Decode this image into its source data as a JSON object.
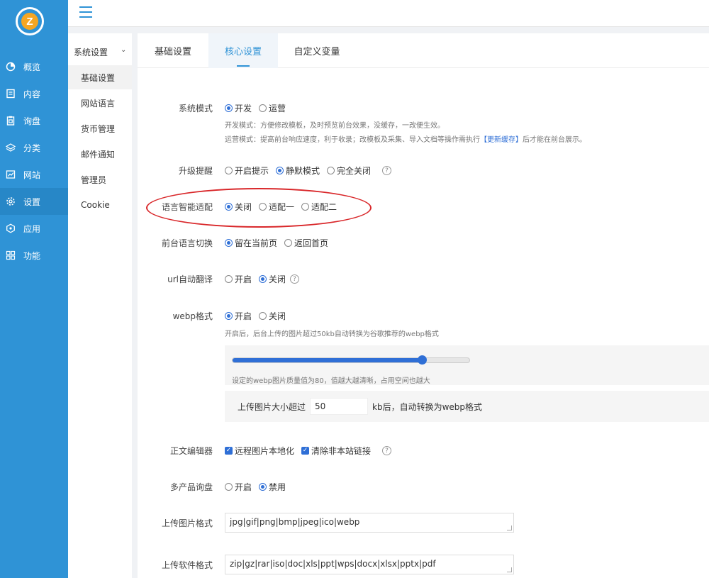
{
  "app": {
    "logo_letter": "Z"
  },
  "nav": {
    "items": [
      {
        "label": "概览",
        "icon": "pie-chart-icon"
      },
      {
        "label": "内容",
        "icon": "document-icon"
      },
      {
        "label": "询盘",
        "icon": "clipboard-icon"
      },
      {
        "label": "分类",
        "icon": "layers-icon"
      },
      {
        "label": "网站",
        "icon": "chart-window-icon"
      },
      {
        "label": "设置",
        "icon": "gear-icon",
        "active": true
      },
      {
        "label": "应用",
        "icon": "hexagon-icon"
      },
      {
        "label": "功能",
        "icon": "grid-icon"
      }
    ]
  },
  "subnav": {
    "title": "系统设置",
    "items": [
      {
        "label": "基础设置",
        "active": true
      },
      {
        "label": "网站语言"
      },
      {
        "label": "货币管理"
      },
      {
        "label": "邮件通知"
      },
      {
        "label": "管理员"
      },
      {
        "label": "Cookie"
      }
    ]
  },
  "tabs": [
    {
      "label": "基础设置"
    },
    {
      "label": "核心设置",
      "active": true
    },
    {
      "label": "自定义变量"
    }
  ],
  "form": {
    "system_mode": {
      "label": "系统模式",
      "options": [
        "开发",
        "运营"
      ],
      "selected": "开发",
      "hint1": "开发模式：方便修改模板，及时预览前台效果，没缓存，一改便生效。",
      "hint2_pre": "运营模式：提高前台响应速度，利于收录；改模板及采集、导入文档等操作需执行",
      "hint2_link": "【更新缓存】",
      "hint2_post": "后才能在前台展示。"
    },
    "upgrade_notice": {
      "label": "升级提醒",
      "options": [
        "开启提示",
        "静默模式",
        "完全关闭"
      ],
      "selected": "静默模式"
    },
    "lang_adapt": {
      "label": "语言智能适配",
      "options": [
        "关闭",
        "适配一",
        "适配二"
      ],
      "selected": "关闭"
    },
    "front_lang_switch": {
      "label": "前台语言切换",
      "options": [
        "留在当前页",
        "返回首页"
      ],
      "selected": "留在当前页"
    },
    "url_translate": {
      "label": "url自动翻译",
      "options": [
        "开启",
        "关闭"
      ],
      "selected": "关闭"
    },
    "webp": {
      "label": "webp格式",
      "options": [
        "开启",
        "关闭"
      ],
      "selected": "开启",
      "hint": "开启后，后台上传的图片超过50kb自动转换为谷歌推荐的webp格式",
      "quality": 80,
      "quality_hint": "设定的webp图片质量值为80，值越大越清晰，占用空间也越大",
      "size_pre": "上传图片大小超过",
      "size_value": "50",
      "size_post": "kb后，自动转换为webp格式"
    },
    "editor": {
      "label": "正文编辑器",
      "checks": [
        "远程图片本地化",
        "清除非本站链接"
      ]
    },
    "multi_inquiry": {
      "label": "多产品询盘",
      "options": [
        "开启",
        "禁用"
      ],
      "selected": "禁用"
    },
    "image_formats": {
      "label": "上传图片格式",
      "value": "jpg|gif|png|bmp|jpeg|ico|webp"
    },
    "software_formats": {
      "label": "上传软件格式",
      "value": "zip|gz|rar|iso|doc|xls|ppt|wps|docx|xlsx|pptx|pdf"
    }
  }
}
